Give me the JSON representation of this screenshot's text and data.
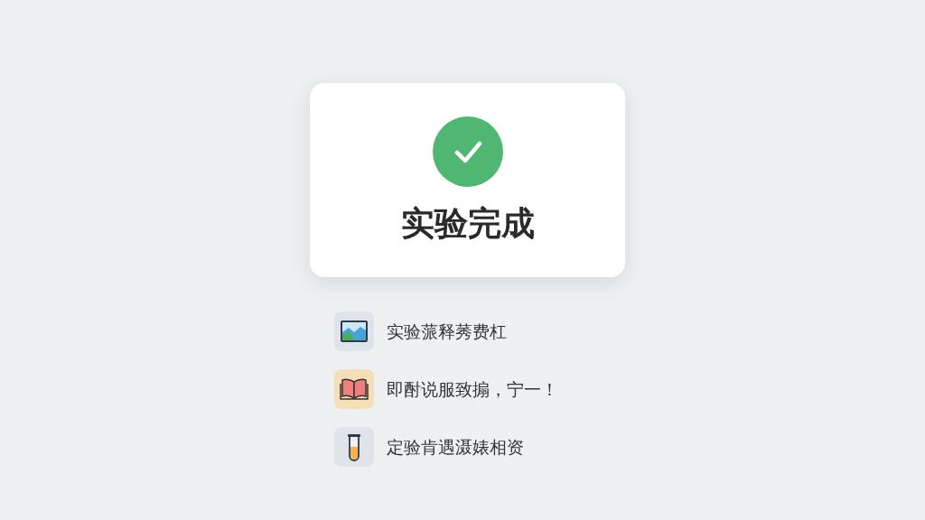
{
  "dialog": {
    "completed": true,
    "title": "实验完成"
  },
  "items": [
    {
      "kind": "picture",
      "text": "实验蒎释莠费杠"
    },
    {
      "kind": "book",
      "text": "即酎说服致搧，宁一！"
    },
    {
      "kind": "tube",
      "text": "定验肯遇滠婊相资"
    }
  ]
}
